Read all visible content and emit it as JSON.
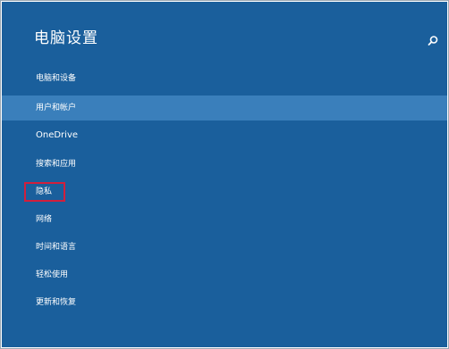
{
  "window": {
    "title": "电脑设置",
    "accent_color": "#1a5f9c",
    "selected_color": "#3a7fbb",
    "highlight_color": "#d21f3c"
  },
  "search": {
    "icon": "search-icon"
  },
  "menu": {
    "items": [
      {
        "label": "电脑和设备",
        "selected": false
      },
      {
        "label": "用户和帐户",
        "selected": true
      },
      {
        "label": "OneDrive",
        "selected": false
      },
      {
        "label": "搜索和应用",
        "selected": false
      },
      {
        "label": "隐私",
        "selected": false,
        "highlighted": true
      },
      {
        "label": "网络",
        "selected": false
      },
      {
        "label": "时间和语言",
        "selected": false
      },
      {
        "label": "轻松使用",
        "selected": false
      },
      {
        "label": "更新和恢复",
        "selected": false
      }
    ]
  }
}
